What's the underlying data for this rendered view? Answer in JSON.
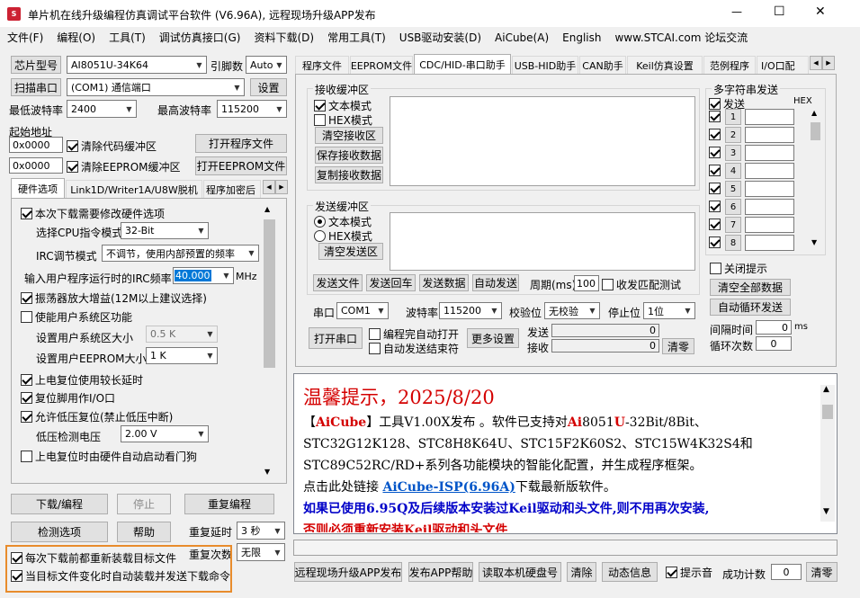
{
  "window": {
    "title": "单片机在线升级编程仿真调试平台软件 (V6.96A), 远程现场升级APP发布",
    "min": "—",
    "max": "☐",
    "close": "✕"
  },
  "menu": [
    "文件(F)",
    "编程(O)",
    "工具(T)",
    "调试仿真接口(G)",
    "资料下载(D)",
    "常用工具(T)",
    "USB驱动安装(D)",
    "AiCube(A)",
    "English",
    "www.STCAI.com 论坛交流"
  ],
  "left": {
    "chip_label": "芯片型号",
    "chip_value": "AI8051U-34K64",
    "pin_label": "引脚数",
    "pin_value": "Auto",
    "scan_btn": "扫描串口",
    "port_value": "(COM1) 通信端口",
    "settings_btn": "设置",
    "min_baud_label": "最低波特率",
    "min_baud": "2400",
    "max_baud_label": "最高波特率",
    "max_baud": "115200",
    "start_addr_label": "起始地址",
    "addr1": "0x0000",
    "clear_code": "清除代码缓冲区",
    "open_prog": "打开程序文件",
    "addr2": "0x0000",
    "clear_eeprom": "清除EEPROM缓冲区",
    "open_eeprom": "打开EEPROM文件",
    "tabs": [
      "硬件选项",
      "Link1D/Writer1A/U8W脱机",
      "程序加密后"
    ],
    "hw": {
      "modify": "本次下载需要修改硬件选项",
      "cpu_label": "选择CPU指令模式",
      "cpu_value": "32-Bit",
      "irc_label": "IRC调节模式",
      "irc_value": "不调节，使用内部预置的频率",
      "freq_label": "输入用户程序运行时的IRC频率",
      "freq_value": "40.000",
      "freq_unit": "MHz",
      "osc": "振荡器放大增益(12M以上建议选择)",
      "sysarea": "使能用户系统区功能",
      "sys_size_label": "设置用户系统区大小",
      "sys_size": "0.5 K",
      "eeprom_size_label": "设置用户EEPROM大小",
      "eeprom_size": "1    K",
      "power_delay": "上电复位使用较长延时",
      "reset_io": "复位脚用作I/O口",
      "lvr": "允许低压复位(禁止低压中断)",
      "lvd_label": "低压检测电压",
      "lvd_value": "2.00 V",
      "watchdog": "上电复位时由硬件自动启动看门狗"
    },
    "download_btn": "下载/编程",
    "stop_btn": "停止",
    "reprog_btn": "重复编程",
    "detect_btn": "检测选项",
    "help_btn": "帮助",
    "delay_label": "重复延时",
    "delay_value": "3 秒",
    "count_label": "重复次数",
    "count_value": "无限",
    "reload": "每次下载前都重新装载目标文件",
    "auto_send": "当目标文件变化时自动装载并发送下载命令"
  },
  "right": {
    "tabs": [
      "程序文件",
      "EEPROM文件",
      "CDC/HID-串口助手",
      "USB-HID助手",
      "CAN助手",
      "Keil仿真设置",
      "范例程序",
      "I/O口配"
    ],
    "recv_group": "接收缓冲区",
    "text_mode": "文本模式",
    "hex_mode": "HEX模式",
    "clear_recv": "清空接收区",
    "save_recv": "保存接收数据",
    "copy_recv": "复制接收数据",
    "send_group": "发送缓冲区",
    "send_text_mode": "文本模式",
    "send_hex_mode": "HEX模式",
    "clear_send": "清空发送区",
    "send_file": "发送文件",
    "send_return": "发送回车",
    "send_data": "发送数据",
    "auto_send": "自动发送",
    "period_label": "周期(ms)",
    "period_value": "100",
    "match_label": "收发匹配测试",
    "port_label": "串口",
    "port_value": "COM1",
    "baud_label": "波特率",
    "baud_value": "115200",
    "parity_label": "校验位",
    "parity_value": "无校验",
    "stop_label": "停止位",
    "stop_value": "1位",
    "open_port": "打开串口",
    "auto_open": "编程完自动打开",
    "auto_close": "自动发送结束符",
    "more": "更多设置",
    "send_count_label": "发送",
    "send_count": "0",
    "recv_count_label": "接收",
    "recv_count": "0",
    "clear_counts": "清零",
    "multi_title": "多字符串发送",
    "multi_send": "发送",
    "multi_hex": "HEX",
    "multi_rows": [
      "1",
      "2",
      "3",
      "4",
      "5",
      "6",
      "7",
      "8"
    ],
    "close_hint": "关闭提示",
    "clear_all": "清空全部数据",
    "auto_loop": "自动循环发送",
    "interval_label": "间隔时间",
    "interval_value": "0",
    "interval_unit": "ms",
    "loop_label": "循环次数",
    "loop_value": "0"
  },
  "notice": {
    "title": "温馨提示，2025/8/20",
    "l1_a": "【",
    "l1_b": "AiCube",
    "l1_c": "】工具V1.00X发布 。软件已支持对",
    "l1_d": "Ai",
    "l1_e": "8051",
    "l1_f": "U",
    "l1_g": "-32Bit/8Bit、",
    "l2": "STC32G12K128、STC8H8K64U、STC15F2K60S2、STC15W4K32S4和",
    "l3": "STC89C52RC/RD+系列各功能模块的智能化配置，并生成程序框架。",
    "l4_a": "点击此处链接  ",
    "l4_b": "AiCube-ISP(6.96A)",
    "l4_c": "下载最新版软件。",
    "l5": "如果已使用6.95Q及后续版本安装过Keil驱动和头文件,则不用再次安装,",
    "l6": "否则必须重新安装Keil驱动和头文件"
  },
  "bottom": {
    "remote": "远程现场升级APP发布",
    "publish_help": "发布APP帮助",
    "read_disk": "读取本机硬盘号",
    "clear": "清除",
    "dynamic": "动态信息",
    "beep": "提示音",
    "success_label": "成功计数",
    "success_value": "0",
    "reset": "清零"
  },
  "colors": {
    "red": "#d40000",
    "blue": "#0000c8",
    "link": "#0055c8",
    "highlight": "#e88c2c"
  }
}
